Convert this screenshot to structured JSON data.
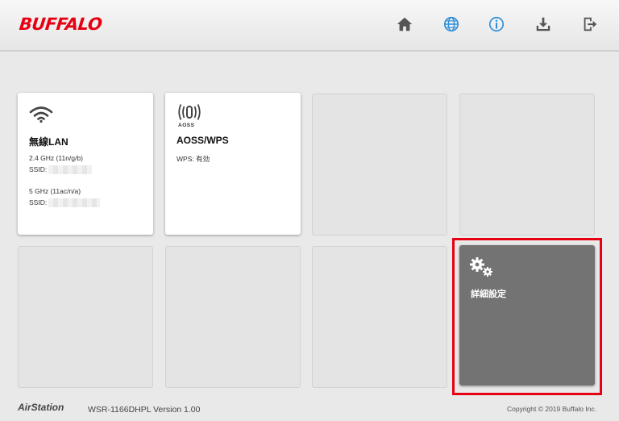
{
  "header": {
    "logo": "BUFFALO",
    "nav": [
      {
        "icon": "home-icon"
      },
      {
        "icon": "globe-icon"
      },
      {
        "icon": "info-icon"
      },
      {
        "icon": "download-icon"
      },
      {
        "icon": "logout-icon"
      }
    ]
  },
  "colors": {
    "brand": "#e60012",
    "accent_blue": "#2f8fd8",
    "nav_gray": "#555555",
    "tile_dark": "#737373",
    "highlight": "#e60012"
  },
  "tiles": {
    "wireless": {
      "title": "無線LAN",
      "band1": "2.4 GHz (11n/g/b)",
      "ssid1_label": "SSID:",
      "band2": "5 GHz (11ac/n/a)",
      "ssid2_label": "SSID:"
    },
    "aoss": {
      "badge": "AOSS",
      "title": "AOSS/WPS",
      "status": "WPS: 有効"
    },
    "advanced": {
      "title": "詳細設定"
    }
  },
  "footer": {
    "brand": "AirStation",
    "model": "WSR-1166DHPL Version 1.00",
    "copyright": "Copyright © 2019 Buffalo Inc."
  }
}
